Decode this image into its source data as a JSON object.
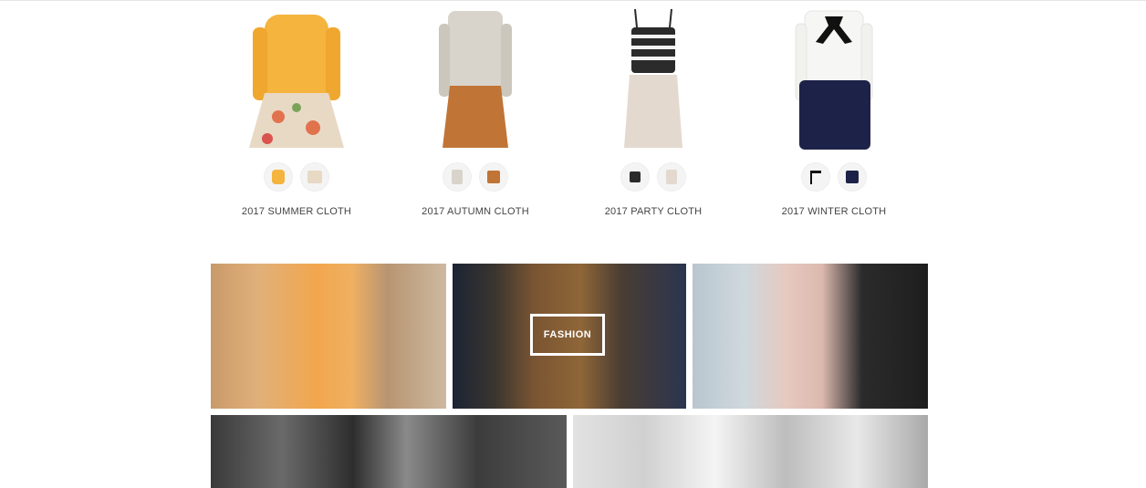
{
  "outfits": [
    {
      "label": "2017 SUMMER CLOTH",
      "top_color": "#f4b43e",
      "bottom_color": "#e8d9c5",
      "accent": "#e0734e"
    },
    {
      "label": "2017 AUTUMN CLOTH",
      "top_color": "#d8d4cb",
      "bottom_color": "#c07436",
      "accent": "#a05a26"
    },
    {
      "label": "2017 PARTY CLOTH",
      "top_color": "#2b2b2b",
      "bottom_color": "#e4d9cf",
      "accent": "#ffffff"
    },
    {
      "label": "2017 WINTER CLOTH",
      "top_color": "#f6f6f4",
      "bottom_color": "#1d2248",
      "accent": "#111111"
    }
  ],
  "gallery": {
    "featured_label": "FASHION"
  },
  "icons": {
    "top_thumb": "top-garment-icon",
    "bottom_thumb": "bottom-garment-icon"
  }
}
